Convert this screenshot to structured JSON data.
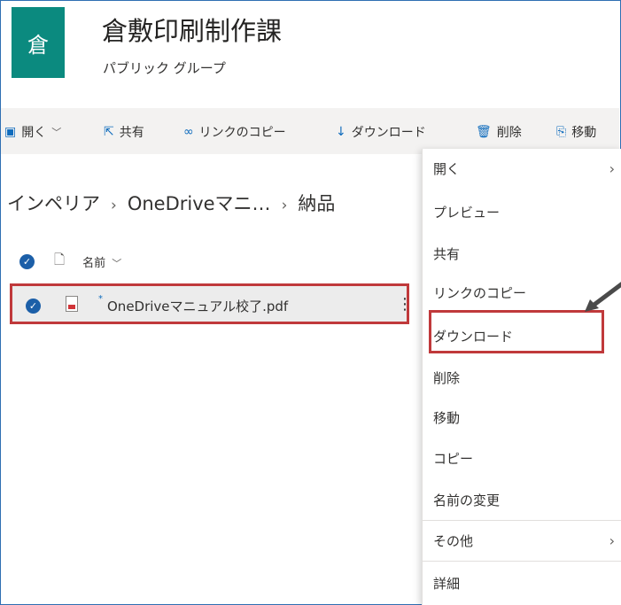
{
  "header": {
    "logo_char": "倉",
    "title": "倉敷印刷制作課",
    "subtitle": "パブリック グループ"
  },
  "command_bar": {
    "open": "開く",
    "share": "共有",
    "copy_link": "リンクのコピー",
    "download": "ダウンロード",
    "delete": "削除",
    "move": "移動"
  },
  "breadcrumb": {
    "items": [
      "インペリア",
      "OneDriveマニ…",
      "納品"
    ]
  },
  "list": {
    "column_name": "名前",
    "file_name": "OneDriveマニュアル校了.pdf"
  },
  "context_menu": {
    "items": [
      "開く",
      "プレビュー",
      "共有",
      "リンクのコピー",
      "ダウンロード",
      "削除",
      "移動",
      "コピー",
      "名前の変更",
      "その他",
      "詳細"
    ]
  },
  "colors": {
    "accent": "#0f6cbd",
    "logo_bg": "#0b8a7f",
    "highlight": "#c0393b"
  }
}
